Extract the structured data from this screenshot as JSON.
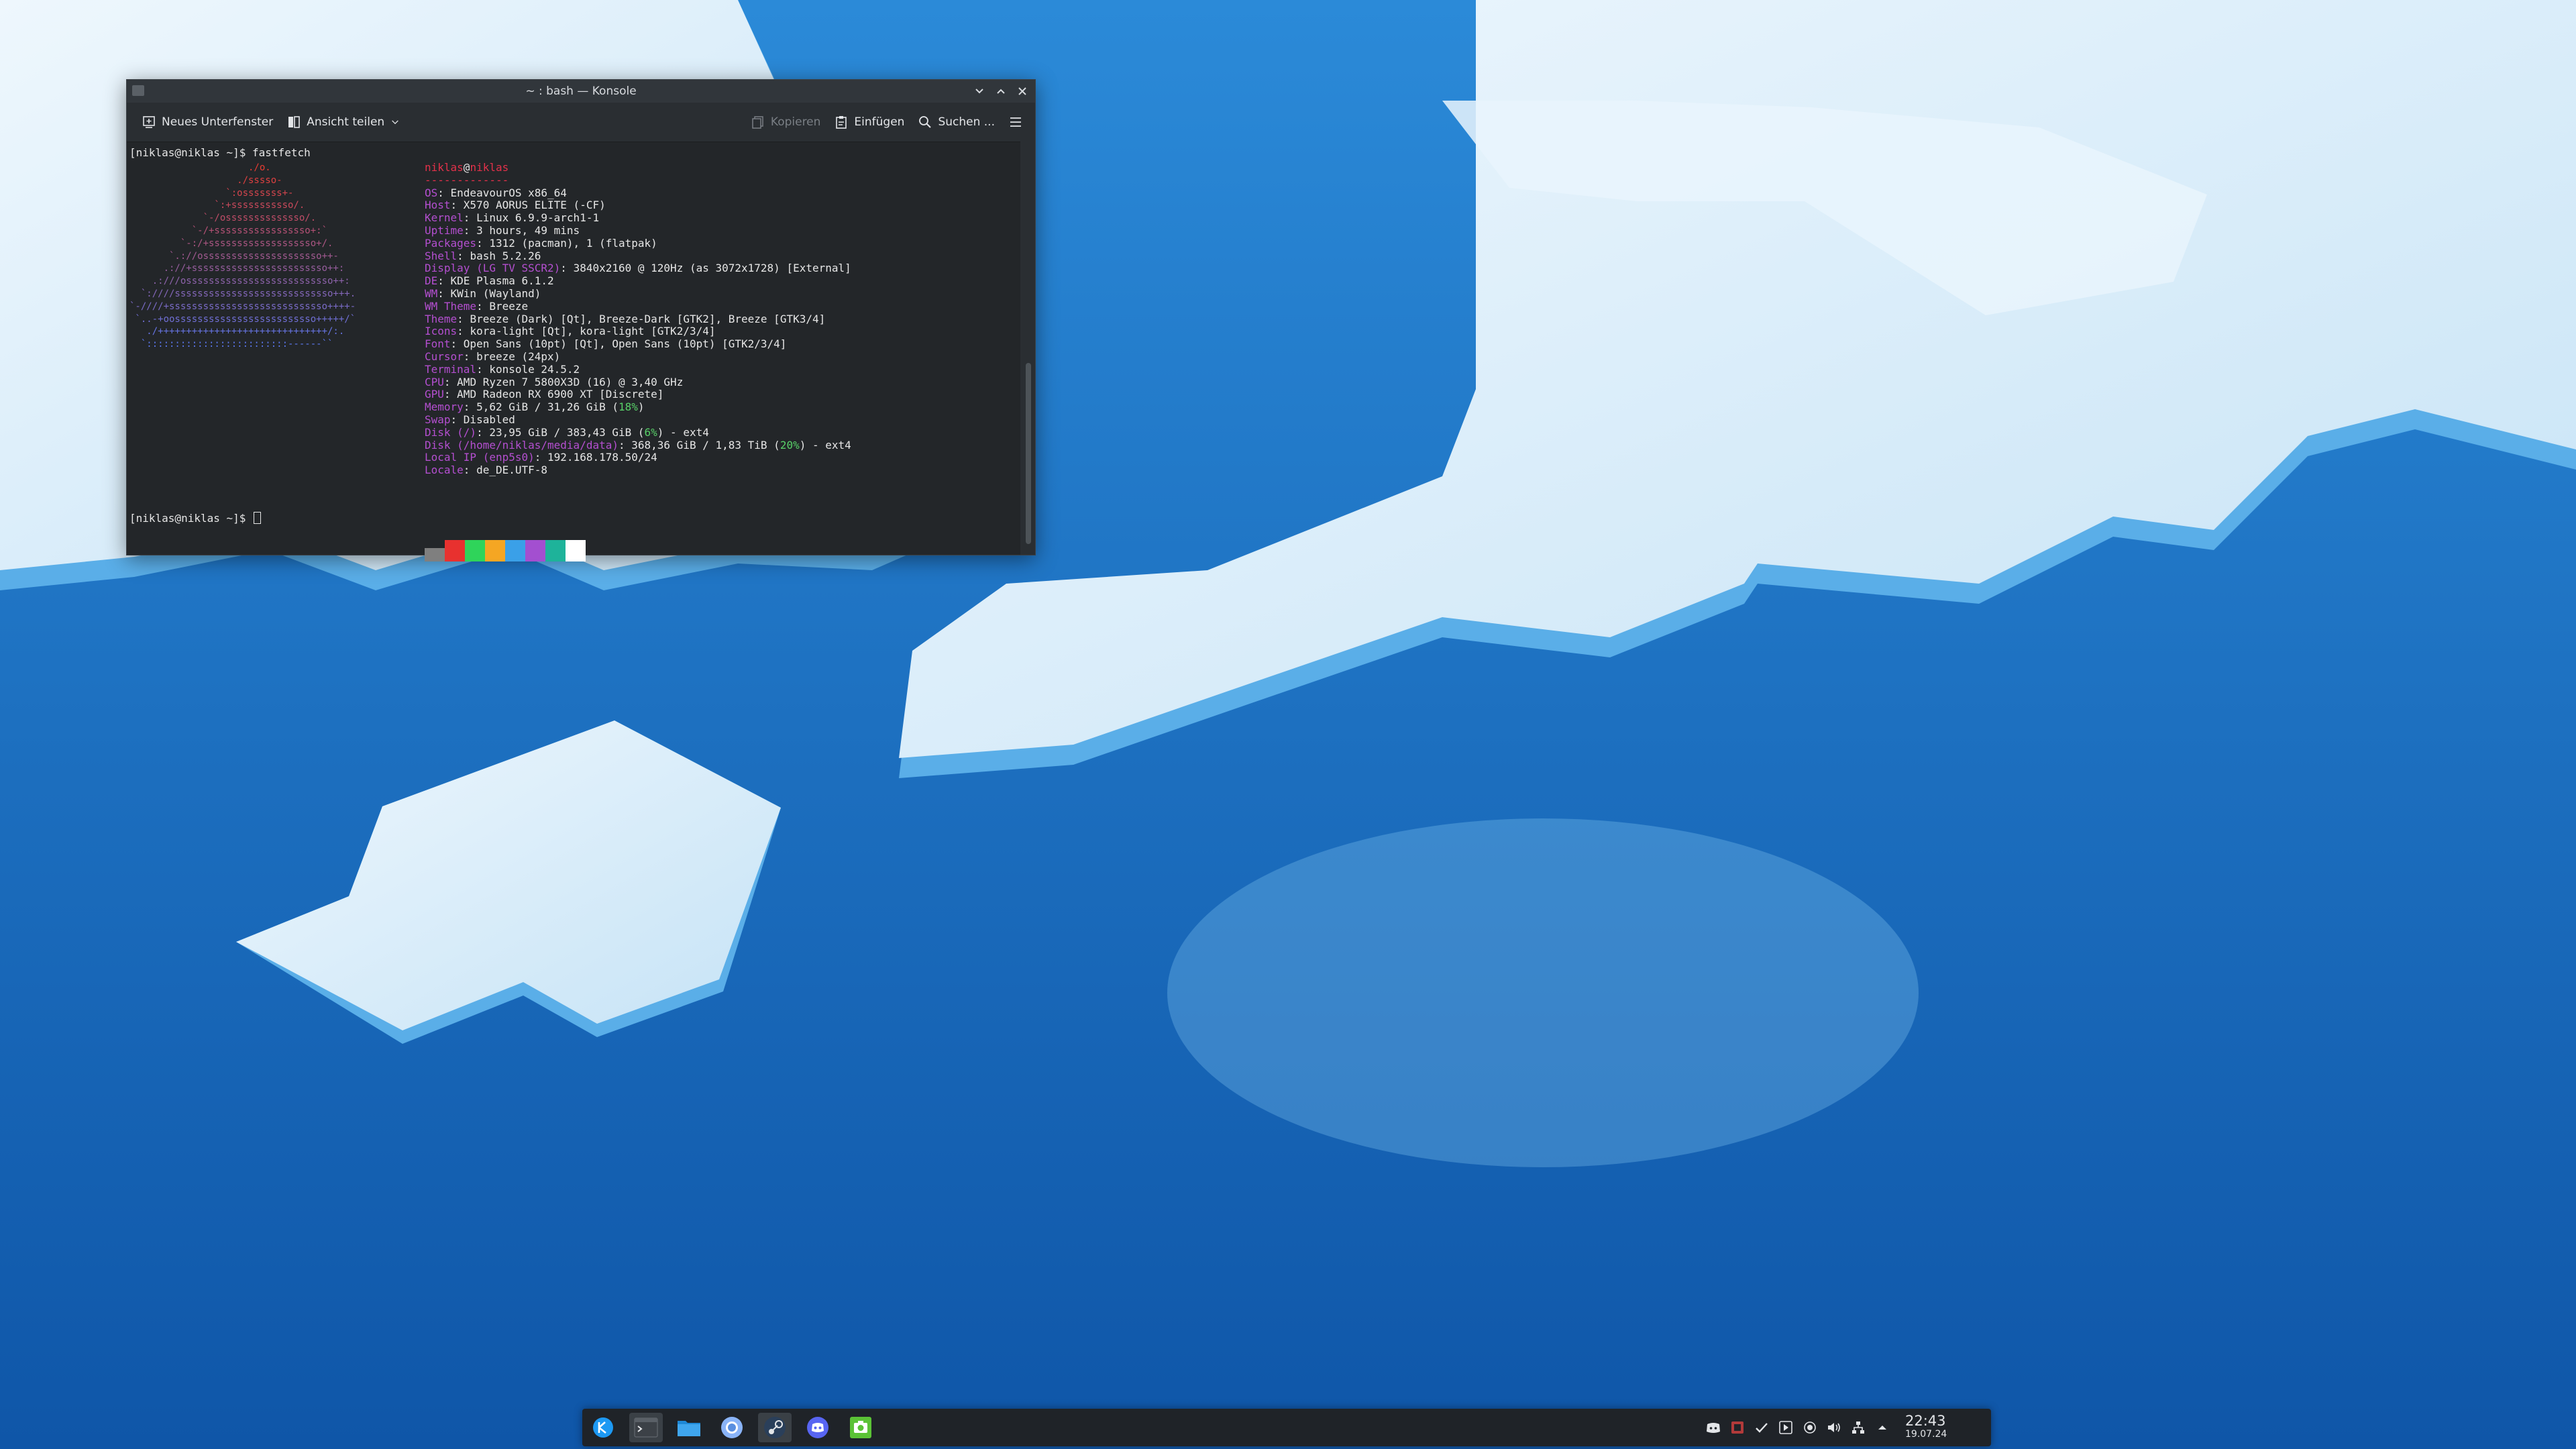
{
  "window": {
    "title": "~ : bash — Konsole",
    "toolbar": {
      "new_tab": "Neues Unterfenster",
      "split_view": "Ansicht teilen",
      "copy": "Kopieren",
      "paste": "Einfügen",
      "find": "Suchen ..."
    }
  },
  "terminal": {
    "command_line": "[niklas@niklas ~]$ fastfetch",
    "prompt_line": "[niklas@niklas ~]$ ",
    "logo_lines": [
      "                     ./o.",
      "                   ./sssso-",
      "                 `:osssssss+-",
      "               `:+sssssssssso/.",
      "             `-/ossssssssssssso/.",
      "           `-/+sssssssssssssssso+:`",
      "         `-:/+sssssssssssssssssso+/.",
      "       `.://osssssssssssssssssssso++-",
      "      .://+ssssssssssssssssssssssso++:",
      "    .:///ossssssssssssssssssssssssso++:",
      "  `:////ssssssssssssssssssssssssssso+++.",
      "`-////+ssssssssssssssssssssssssssso++++-",
      " `..-+oosssssssssssssssssssssssso+++++/`",
      "   ./++++++++++++++++++++++++++++++/:.",
      "  `:::::::::::::::::::::::::------``"
    ],
    "user": "niklas",
    "host": "niklas",
    "separator": "-------------",
    "info": [
      {
        "key": "OS",
        "value": ": EndeavourOS x86_64"
      },
      {
        "key": "Host",
        "value": ": X570 AORUS ELITE (-CF)"
      },
      {
        "key": "Kernel",
        "value": ": Linux 6.9.9-arch1-1"
      },
      {
        "key": "Uptime",
        "value": ": 3 hours, 49 mins"
      },
      {
        "key": "Packages",
        "value": ": 1312 (pacman), 1 (flatpak)"
      },
      {
        "key": "Shell",
        "value": ": bash 5.2.26"
      },
      {
        "key": "Display (LG TV SSCR2)",
        "value": ": 3840x2160 @ 120Hz (as 3072x1728) [External]"
      },
      {
        "key": "DE",
        "value": ": KDE Plasma 6.1.2"
      },
      {
        "key": "WM",
        "value": ": KWin (Wayland)"
      },
      {
        "key": "WM Theme",
        "value": ": Breeze"
      },
      {
        "key": "Theme",
        "value": ": Breeze (Dark) [Qt], Breeze-Dark [GTK2], Breeze [GTK3/4]"
      },
      {
        "key": "Icons",
        "value": ": kora-light [Qt], kora-light [GTK2/3/4]"
      },
      {
        "key": "Font",
        "value": ": Open Sans (10pt) [Qt], Open Sans (10pt) [GTK2/3/4]"
      },
      {
        "key": "Cursor",
        "value": ": breeze (24px)"
      },
      {
        "key": "Terminal",
        "value": ": konsole 24.5.2"
      },
      {
        "key": "CPU",
        "value": ": AMD Ryzen 7 5800X3D (16) @ 3,40 GHz"
      },
      {
        "key": "GPU",
        "value": ": AMD Radeon RX 6900 XT [Discrete]"
      },
      {
        "key": "Memory",
        "value": ": 5,62 GiB / 31,26 GiB (",
        "pct": "18%",
        "tail": ")"
      },
      {
        "key": "Swap",
        "value": ": Disabled"
      },
      {
        "key": "Disk (/)",
        "value": ": 23,95 GiB / 383,43 GiB (",
        "pct": "6%",
        "tail": ") - ext4"
      },
      {
        "key": "Disk (/home/niklas/media/data)",
        "value": ": 368,36 GiB / 1,83 TiB (",
        "pct": "20%",
        "tail": ") - ext4"
      },
      {
        "key": "Local IP (enp5s0)",
        "value": ": 192.168.178.50/24"
      },
      {
        "key": "Locale",
        "value": ": de_DE.UTF-8"
      }
    ],
    "swatch_colors": [
      "#7f7f7f",
      "#e8312f",
      "#2fd45a",
      "#f5a623",
      "#3aa0e8",
      "#a34fd0",
      "#1eb39a",
      "#ffffff"
    ]
  },
  "taskbar": {
    "clock_time": "22:43",
    "clock_date": "19.07.24"
  },
  "colors": {
    "panel_bg": "#1f2328",
    "terminal_bg": "#232629",
    "key_color": "#b44fd0",
    "user_color": "#e3314a"
  }
}
